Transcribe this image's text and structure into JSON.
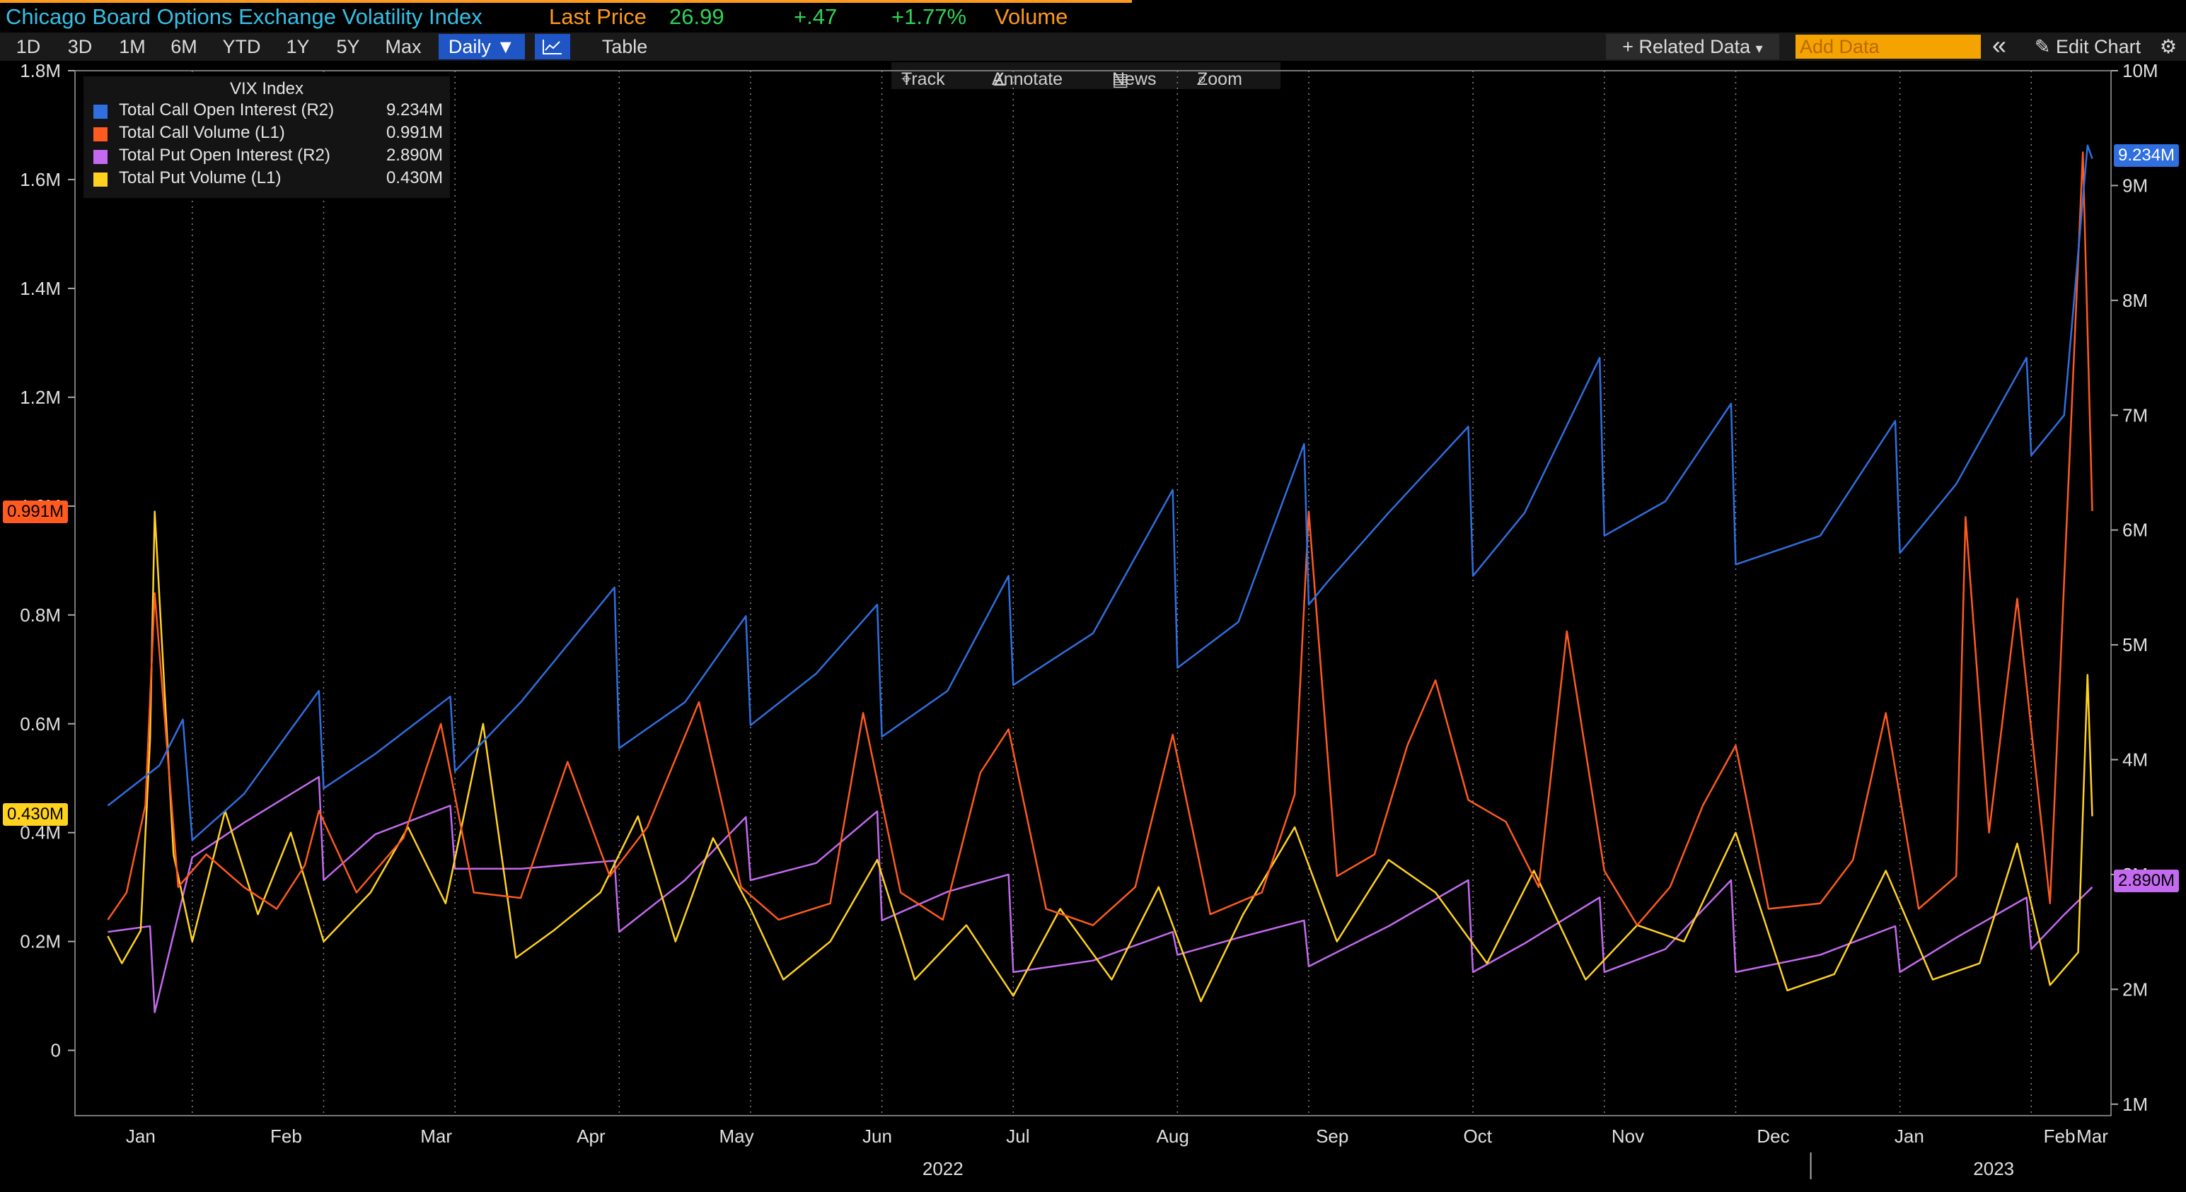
{
  "header": {
    "security": "Chicago Board Options Exchange Volatility Index",
    "last_price_label": "Last Price",
    "last_price": "26.99",
    "change": "+.47",
    "change_pct": "+1.77%",
    "volume_label": "Volume"
  },
  "toolbar": {
    "ranges": [
      "1D",
      "3D",
      "1M",
      "6M",
      "YTD",
      "1Y",
      "5Y",
      "Max"
    ],
    "frequency": "Daily",
    "frequency_arrow": "▼",
    "table_label": "Table",
    "related_data": "+ Related Data",
    "related_caret": "▾",
    "add_data_placeholder": "Add Data",
    "collapse_glyph": "«",
    "edit_chart": "Edit Chart",
    "settings_glyph": "⚙"
  },
  "chart_toolbar": {
    "track": "Track",
    "annotate": "Annotate",
    "news": "News",
    "zoom": "Zoom"
  },
  "colors": {
    "call_oi": "#2f6fe0",
    "call_vol": "#ff5a1f",
    "put_oi": "#c46af0",
    "put_vol": "#ffd21f",
    "toolbar_selected": "#1f55c4",
    "header_title": "#35c0e8",
    "header_orange": "#ff9a1f",
    "header_green": "#2fd35a"
  },
  "chart_data": {
    "type": "line",
    "title": "VIX Index",
    "left_axis": {
      "ylim": [
        -0.12,
        1.8
      ],
      "unit": "M",
      "ticks": [
        {
          "v": 0,
          "label": "0"
        },
        {
          "v": 0.2,
          "label": "0.2M"
        },
        {
          "v": 0.4,
          "label": "0.4M"
        },
        {
          "v": 0.6,
          "label": "0.6M"
        },
        {
          "v": 0.8,
          "label": "0.8M"
        },
        {
          "v": 1.0,
          "label": "1.0M"
        },
        {
          "v": 1.2,
          "label": "1.2M"
        },
        {
          "v": 1.4,
          "label": "1.4M"
        },
        {
          "v": 1.6,
          "label": "1.6M"
        },
        {
          "v": 1.8,
          "label": "1.8M"
        }
      ]
    },
    "right_axis": {
      "ylim": [
        0.9,
        10.0
      ],
      "unit": "M",
      "ticks": [
        {
          "v": 1,
          "label": "1M"
        },
        {
          "v": 2,
          "label": "2M"
        },
        {
          "v": 3,
          "label": "3M"
        },
        {
          "v": 4,
          "label": "4M"
        },
        {
          "v": 5,
          "label": "5M"
        },
        {
          "v": 6,
          "label": "6M"
        },
        {
          "v": 7,
          "label": "7M"
        },
        {
          "v": 8,
          "label": "8M"
        },
        {
          "v": 9,
          "label": "9M"
        },
        {
          "v": 10,
          "label": "10M"
        }
      ]
    },
    "x_axis": {
      "domain": [
        "2021-12-27",
        "2023-03-06"
      ],
      "month_labels": [
        {
          "date": "2022-01-10",
          "label": "Jan"
        },
        {
          "date": "2022-02-10",
          "label": "Feb"
        },
        {
          "date": "2022-03-14",
          "label": "Mar"
        },
        {
          "date": "2022-04-16",
          "label": "Apr"
        },
        {
          "date": "2022-05-17",
          "label": "May"
        },
        {
          "date": "2022-06-16",
          "label": "Jun"
        },
        {
          "date": "2022-07-16",
          "label": "Jul"
        },
        {
          "date": "2022-08-18",
          "label": "Aug"
        },
        {
          "date": "2022-09-21",
          "label": "Sep"
        },
        {
          "date": "2022-10-22",
          "label": "Oct"
        },
        {
          "date": "2022-11-23",
          "label": "Nov"
        },
        {
          "date": "2022-12-24",
          "label": "Dec"
        },
        {
          "date": "2023-01-22",
          "label": "Jan"
        },
        {
          "date": "2023-02-23",
          "label": "Feb"
        },
        {
          "date": "2023-03-02",
          "label": "Mar"
        }
      ],
      "year_labels": [
        {
          "date": "2022-06-30",
          "label": "2022"
        },
        {
          "date": "2023-02-09",
          "label": "2023"
        }
      ],
      "expiry_gridlines": [
        "2022-01-21",
        "2022-02-18",
        "2022-03-18",
        "2022-04-22",
        "2022-05-20",
        "2022-06-17",
        "2022-07-15",
        "2022-08-19",
        "2022-09-16",
        "2022-10-21",
        "2022-11-18",
        "2022-12-16",
        "2023-01-20",
        "2023-02-17"
      ],
      "year_divider": "2023-01-01"
    },
    "series": [
      {
        "name": "Total Call Open Interest",
        "axis_label": "(R2)",
        "axis": "right",
        "last_label": "9.234M",
        "points": [
          [
            "2022-01-03",
            3.6
          ],
          [
            "2022-01-14",
            3.95
          ],
          [
            "2022-01-19",
            4.35
          ],
          [
            "2022-01-21",
            3.3
          ],
          [
            "2022-02-01",
            3.7
          ],
          [
            "2022-02-17",
            4.6
          ],
          [
            "2022-02-18",
            3.75
          ],
          [
            "2022-03-01",
            4.05
          ],
          [
            "2022-03-17",
            4.55
          ],
          [
            "2022-03-18",
            3.9
          ],
          [
            "2022-04-01",
            4.5
          ],
          [
            "2022-04-21",
            5.5
          ],
          [
            "2022-04-22",
            4.1
          ],
          [
            "2022-05-06",
            4.5
          ],
          [
            "2022-05-19",
            5.25
          ],
          [
            "2022-05-20",
            4.3
          ],
          [
            "2022-06-03",
            4.75
          ],
          [
            "2022-06-16",
            5.35
          ],
          [
            "2022-06-17",
            4.2
          ],
          [
            "2022-07-01",
            4.6
          ],
          [
            "2022-07-14",
            5.6
          ],
          [
            "2022-07-15",
            4.65
          ],
          [
            "2022-08-01",
            5.1
          ],
          [
            "2022-08-18",
            6.35
          ],
          [
            "2022-08-19",
            4.8
          ],
          [
            "2022-09-01",
            5.2
          ],
          [
            "2022-09-15",
            6.75
          ],
          [
            "2022-09-16",
            5.35
          ],
          [
            "2022-09-20",
            5.55
          ],
          [
            "2022-10-03",
            6.15
          ],
          [
            "2022-10-20",
            6.9
          ],
          [
            "2022-10-21",
            5.6
          ],
          [
            "2022-11-01",
            6.15
          ],
          [
            "2022-11-17",
            7.5
          ],
          [
            "2022-11-18",
            5.95
          ],
          [
            "2022-12-01",
            6.25
          ],
          [
            "2022-12-15",
            7.1
          ],
          [
            "2022-12-16",
            5.7
          ],
          [
            "2023-01-03",
            5.95
          ],
          [
            "2023-01-19",
            6.95
          ],
          [
            "2023-01-20",
            5.8
          ],
          [
            "2023-02-01",
            6.4
          ],
          [
            "2023-02-16",
            7.5
          ],
          [
            "2023-02-17",
            6.65
          ],
          [
            "2023-02-24",
            7.0
          ],
          [
            "2023-03-01",
            9.35
          ],
          [
            "2023-03-02",
            9.234
          ]
        ]
      },
      {
        "name": "Total Call Volume",
        "axis_label": "(L1)",
        "axis": "left",
        "last_label": "0.991M",
        "points": [
          [
            "2022-01-03",
            0.24
          ],
          [
            "2022-01-07",
            0.29
          ],
          [
            "2022-01-11",
            0.45
          ],
          [
            "2022-01-13",
            0.84
          ],
          [
            "2022-01-18",
            0.3
          ],
          [
            "2022-01-24",
            0.36
          ],
          [
            "2022-02-01",
            0.3
          ],
          [
            "2022-02-08",
            0.26
          ],
          [
            "2022-02-14",
            0.34
          ],
          [
            "2022-02-17",
            0.44
          ],
          [
            "2022-02-25",
            0.29
          ],
          [
            "2022-03-07",
            0.39
          ],
          [
            "2022-03-15",
            0.6
          ],
          [
            "2022-03-22",
            0.29
          ],
          [
            "2022-04-01",
            0.28
          ],
          [
            "2022-04-11",
            0.53
          ],
          [
            "2022-04-20",
            0.32
          ],
          [
            "2022-04-28",
            0.41
          ],
          [
            "2022-05-09",
            0.64
          ],
          [
            "2022-05-18",
            0.3
          ],
          [
            "2022-05-26",
            0.24
          ],
          [
            "2022-06-06",
            0.27
          ],
          [
            "2022-06-13",
            0.62
          ],
          [
            "2022-06-21",
            0.29
          ],
          [
            "2022-06-30",
            0.24
          ],
          [
            "2022-07-08",
            0.51
          ],
          [
            "2022-07-14",
            0.59
          ],
          [
            "2022-07-22",
            0.26
          ],
          [
            "2022-08-01",
            0.23
          ],
          [
            "2022-08-10",
            0.3
          ],
          [
            "2022-08-18",
            0.58
          ],
          [
            "2022-08-26",
            0.25
          ],
          [
            "2022-09-06",
            0.29
          ],
          [
            "2022-09-13",
            0.47
          ],
          [
            "2022-09-16",
            0.99
          ],
          [
            "2022-09-22",
            0.32
          ],
          [
            "2022-09-30",
            0.36
          ],
          [
            "2022-10-07",
            0.56
          ],
          [
            "2022-10-13",
            0.68
          ],
          [
            "2022-10-20",
            0.46
          ],
          [
            "2022-10-28",
            0.42
          ],
          [
            "2022-11-04",
            0.3
          ],
          [
            "2022-11-10",
            0.77
          ],
          [
            "2022-11-18",
            0.33
          ],
          [
            "2022-11-25",
            0.23
          ],
          [
            "2022-12-02",
            0.3
          ],
          [
            "2022-12-09",
            0.45
          ],
          [
            "2022-12-16",
            0.56
          ],
          [
            "2022-12-23",
            0.26
          ],
          [
            "2023-01-03",
            0.27
          ],
          [
            "2023-01-10",
            0.35
          ],
          [
            "2023-01-17",
            0.62
          ],
          [
            "2023-01-24",
            0.26
          ],
          [
            "2023-02-01",
            0.32
          ],
          [
            "2023-02-03",
            0.98
          ],
          [
            "2023-02-08",
            0.4
          ],
          [
            "2023-02-14",
            0.83
          ],
          [
            "2023-02-21",
            0.27
          ],
          [
            "2023-02-24",
            0.86
          ],
          [
            "2023-02-28",
            1.65
          ],
          [
            "2023-03-02",
            0.991
          ]
        ]
      },
      {
        "name": "Total Put Open Interest",
        "axis_label": "(R2)",
        "axis": "right",
        "last_label": "2.890M",
        "points": [
          [
            "2022-01-03",
            2.5
          ],
          [
            "2022-01-12",
            2.55
          ],
          [
            "2022-01-13",
            1.8
          ],
          [
            "2022-01-21",
            3.15
          ],
          [
            "2022-02-01",
            3.45
          ],
          [
            "2022-02-17",
            3.85
          ],
          [
            "2022-02-18",
            2.95
          ],
          [
            "2022-03-01",
            3.35
          ],
          [
            "2022-03-17",
            3.6
          ],
          [
            "2022-03-18",
            3.05
          ],
          [
            "2022-04-01",
            3.05
          ],
          [
            "2022-04-21",
            3.12
          ],
          [
            "2022-04-22",
            2.5
          ],
          [
            "2022-05-06",
            2.95
          ],
          [
            "2022-05-19",
            3.5
          ],
          [
            "2022-05-20",
            2.95
          ],
          [
            "2022-06-03",
            3.1
          ],
          [
            "2022-06-16",
            3.55
          ],
          [
            "2022-06-17",
            2.6
          ],
          [
            "2022-07-01",
            2.85
          ],
          [
            "2022-07-14",
            3.0
          ],
          [
            "2022-07-15",
            2.15
          ],
          [
            "2022-08-01",
            2.25
          ],
          [
            "2022-08-18",
            2.5
          ],
          [
            "2022-08-19",
            2.3
          ],
          [
            "2022-09-01",
            2.45
          ],
          [
            "2022-09-15",
            2.6
          ],
          [
            "2022-09-16",
            2.2
          ],
          [
            "2022-10-03",
            2.55
          ],
          [
            "2022-10-20",
            2.95
          ],
          [
            "2022-10-21",
            2.15
          ],
          [
            "2022-11-01",
            2.4
          ],
          [
            "2022-11-17",
            2.8
          ],
          [
            "2022-11-18",
            2.15
          ],
          [
            "2022-12-01",
            2.35
          ],
          [
            "2022-12-15",
            2.95
          ],
          [
            "2022-12-16",
            2.15
          ],
          [
            "2023-01-03",
            2.3
          ],
          [
            "2023-01-19",
            2.55
          ],
          [
            "2023-01-20",
            2.15
          ],
          [
            "2023-02-01",
            2.45
          ],
          [
            "2023-02-16",
            2.8
          ],
          [
            "2023-02-17",
            2.35
          ],
          [
            "2023-02-24",
            2.65
          ],
          [
            "2023-03-02",
            2.89
          ]
        ]
      },
      {
        "name": "Total Put Volume",
        "axis_label": "(L1)",
        "axis": "left",
        "last_label": "0.430M",
        "points": [
          [
            "2022-01-03",
            0.21
          ],
          [
            "2022-01-06",
            0.16
          ],
          [
            "2022-01-10",
            0.22
          ],
          [
            "2022-01-12",
            0.57
          ],
          [
            "2022-01-13",
            0.99
          ],
          [
            "2022-01-17",
            0.36
          ],
          [
            "2022-01-21",
            0.2
          ],
          [
            "2022-01-28",
            0.44
          ],
          [
            "2022-02-04",
            0.25
          ],
          [
            "2022-02-11",
            0.4
          ],
          [
            "2022-02-18",
            0.2
          ],
          [
            "2022-02-28",
            0.29
          ],
          [
            "2022-03-08",
            0.41
          ],
          [
            "2022-03-16",
            0.27
          ],
          [
            "2022-03-24",
            0.6
          ],
          [
            "2022-03-31",
            0.17
          ],
          [
            "2022-04-08",
            0.22
          ],
          [
            "2022-04-18",
            0.29
          ],
          [
            "2022-04-26",
            0.43
          ],
          [
            "2022-05-04",
            0.2
          ],
          [
            "2022-05-12",
            0.39
          ],
          [
            "2022-05-20",
            0.26
          ],
          [
            "2022-05-27",
            0.13
          ],
          [
            "2022-06-06",
            0.2
          ],
          [
            "2022-06-16",
            0.35
          ],
          [
            "2022-06-24",
            0.13
          ],
          [
            "2022-07-05",
            0.23
          ],
          [
            "2022-07-15",
            0.1
          ],
          [
            "2022-07-25",
            0.26
          ],
          [
            "2022-08-05",
            0.13
          ],
          [
            "2022-08-15",
            0.3
          ],
          [
            "2022-08-24",
            0.09
          ],
          [
            "2022-09-02",
            0.25
          ],
          [
            "2022-09-13",
            0.41
          ],
          [
            "2022-09-22",
            0.2
          ],
          [
            "2022-10-03",
            0.35
          ],
          [
            "2022-10-13",
            0.29
          ],
          [
            "2022-10-24",
            0.16
          ],
          [
            "2022-11-03",
            0.33
          ],
          [
            "2022-11-14",
            0.13
          ],
          [
            "2022-11-25",
            0.23
          ],
          [
            "2022-12-05",
            0.2
          ],
          [
            "2022-12-16",
            0.4
          ],
          [
            "2022-12-27",
            0.11
          ],
          [
            "2023-01-06",
            0.14
          ],
          [
            "2023-01-17",
            0.33
          ],
          [
            "2023-01-27",
            0.13
          ],
          [
            "2023-02-06",
            0.16
          ],
          [
            "2023-02-14",
            0.38
          ],
          [
            "2023-02-21",
            0.12
          ],
          [
            "2023-02-27",
            0.18
          ],
          [
            "2023-03-01",
            0.69
          ],
          [
            "2023-03-02",
            0.43
          ]
        ]
      }
    ],
    "grid": "vertical dotted gridlines at monthly expirations",
    "legend": "top-left"
  }
}
